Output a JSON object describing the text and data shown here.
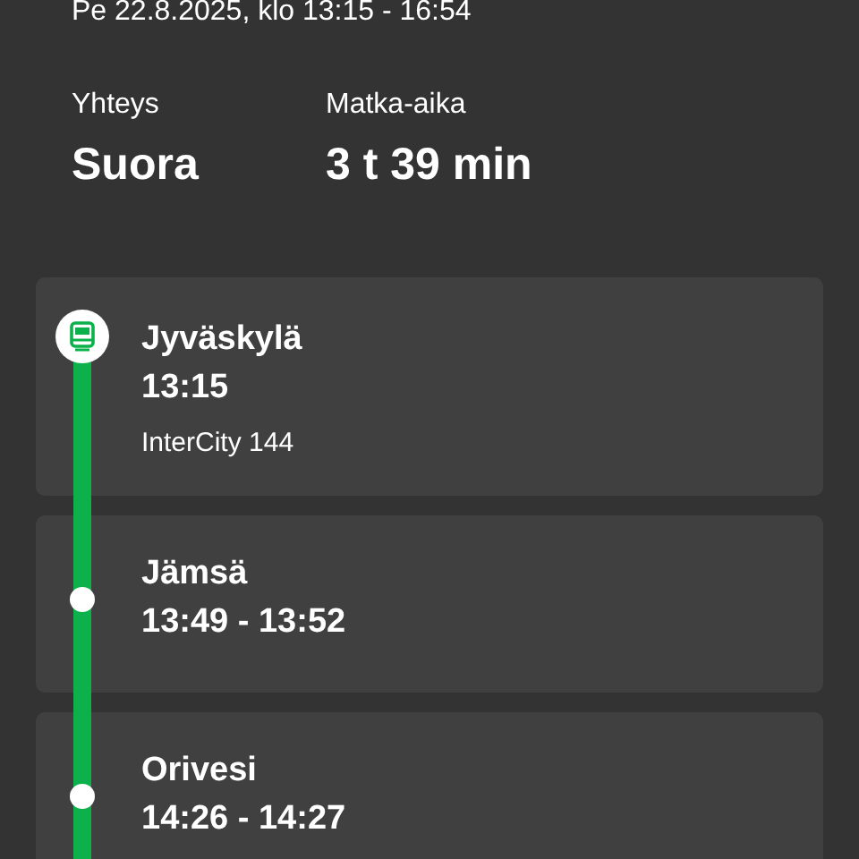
{
  "date_line": "Pe 22.8.2025, klo 13:15 - 16:54",
  "summary": [
    {
      "label": "Yhteys",
      "value": "Suora"
    },
    {
      "label": "Matka-aika",
      "value": "3 t 39 min"
    }
  ],
  "stops": [
    {
      "kind": "origin",
      "name": "Jyväskylä",
      "time": "13:15",
      "train": "InterCity 144"
    },
    {
      "kind": "stop",
      "name": "Jämsä",
      "time": "13:49 - 13:52"
    },
    {
      "kind": "stop",
      "name": "Orivesi",
      "time": "14:26 - 14:27"
    }
  ]
}
